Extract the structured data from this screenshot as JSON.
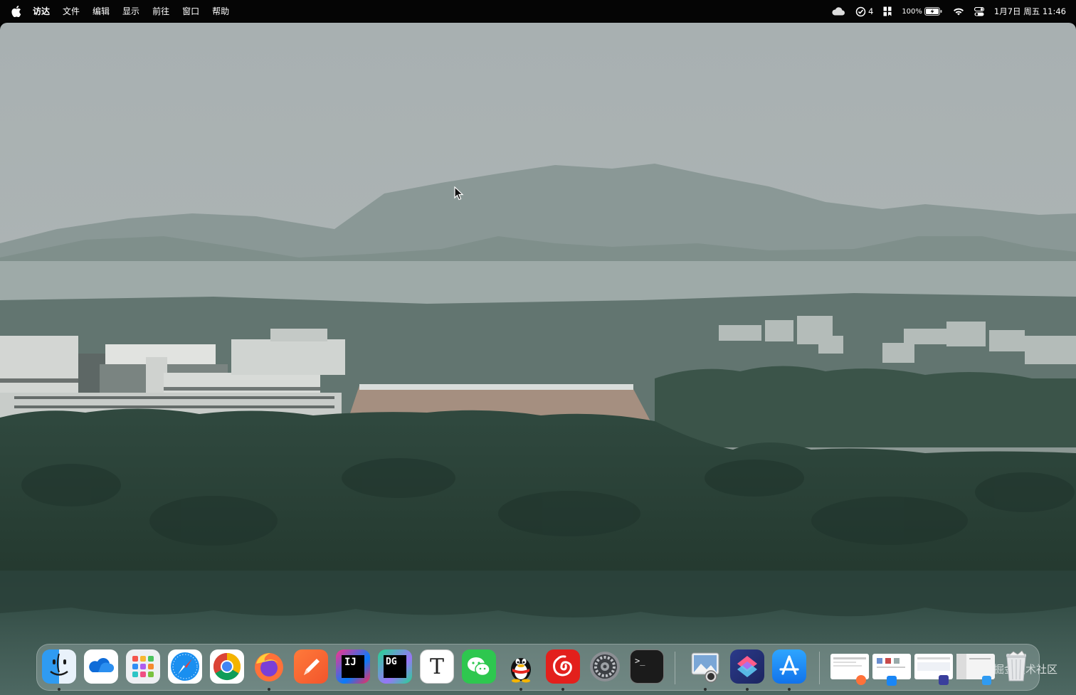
{
  "menubar": {
    "app_name": "访达",
    "menus": [
      "文件",
      "编辑",
      "显示",
      "前往",
      "窗口",
      "帮助"
    ],
    "status": {
      "todo_count": "4",
      "battery": "100%",
      "datetime": "1月7日 周五 11:46"
    }
  },
  "dock": {
    "apps": [
      {
        "name": "finder-icon",
        "running": true
      },
      {
        "name": "onedrive-icon",
        "running": false
      },
      {
        "name": "launchpad-icon",
        "running": false
      },
      {
        "name": "safari-icon",
        "running": false
      },
      {
        "name": "chrome-icon",
        "running": false
      },
      {
        "name": "firefox-icon",
        "running": true
      },
      {
        "name": "pen-app-icon",
        "running": false
      },
      {
        "name": "intellij-idea-icon",
        "running": false
      },
      {
        "name": "datagrip-icon",
        "running": false
      },
      {
        "name": "typora-icon",
        "running": false
      },
      {
        "name": "wechat-icon",
        "running": false
      },
      {
        "name": "qq-icon",
        "running": true
      },
      {
        "name": "netease-music-icon",
        "running": true
      },
      {
        "name": "system-preferences-icon",
        "running": false
      },
      {
        "name": "terminal-icon",
        "running": false
      }
    ],
    "labels": {
      "intellij": "IJ",
      "datagrip": "DG",
      "typora": "T",
      "terminal": ">_"
    }
  },
  "watermark": "@稀土掘金技术社区",
  "colors": {
    "menubar_bg": "#050505",
    "sky": "#aab3b2",
    "forest": "#2e4a40",
    "water": "#3c5750"
  }
}
